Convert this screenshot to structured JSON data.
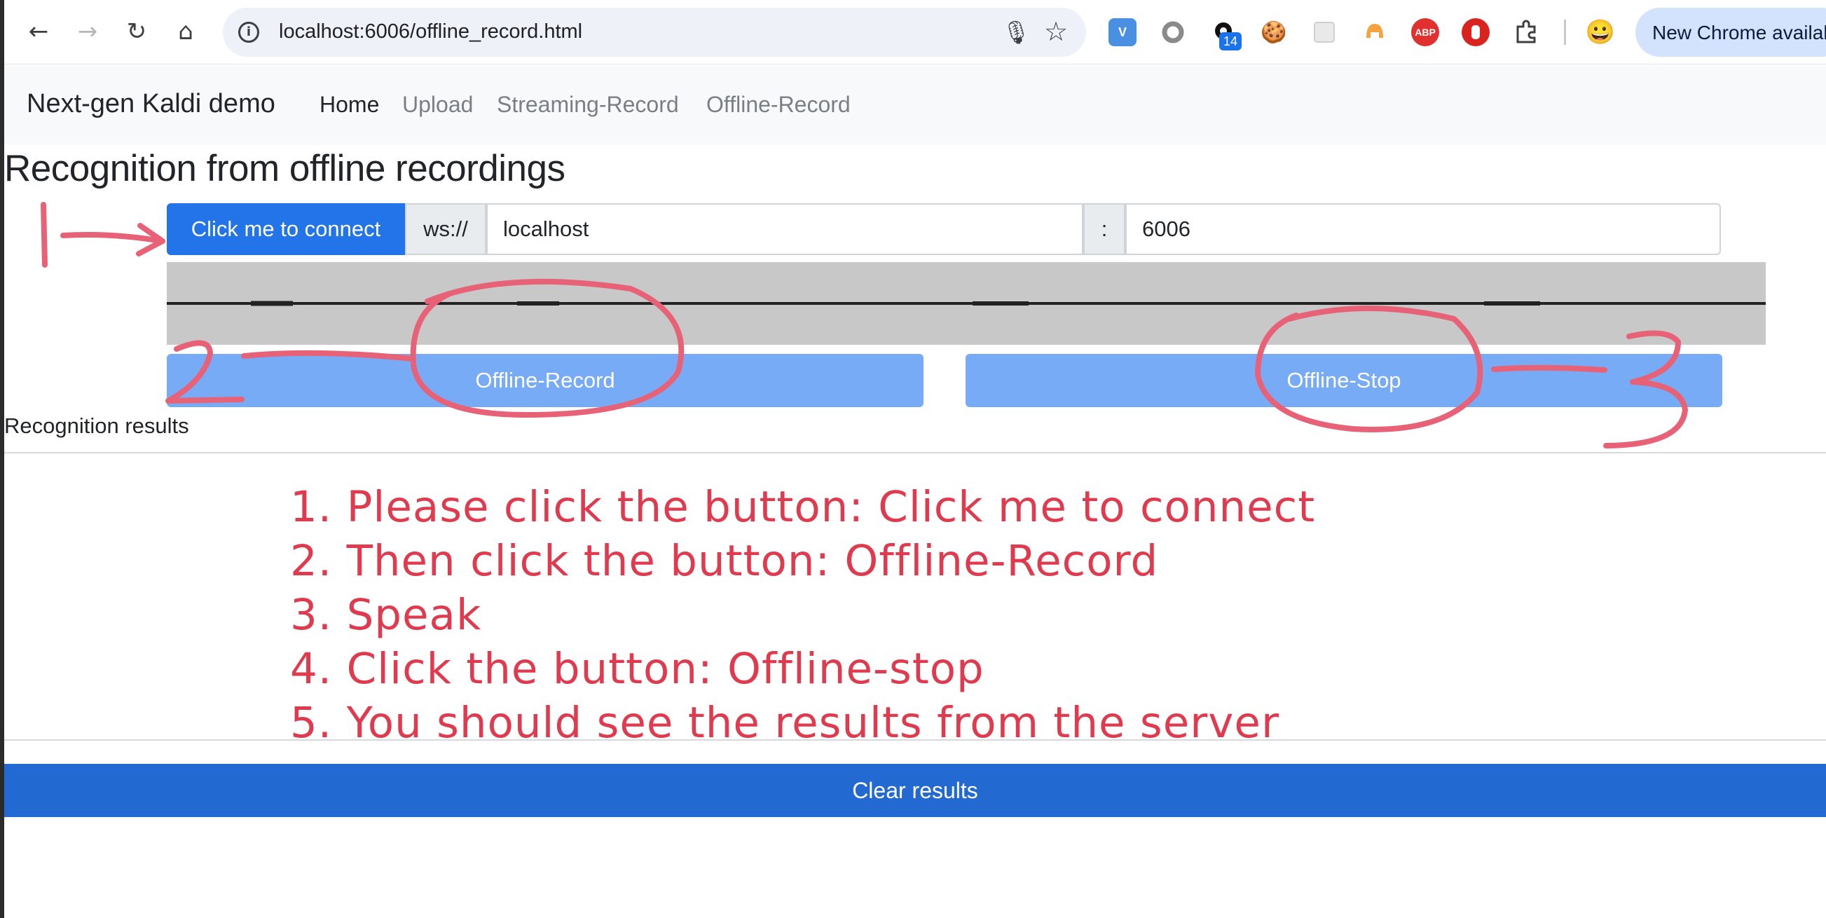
{
  "browser": {
    "url": "localhost:6006/offline_record.html",
    "update_pill": "New Chrome availabl",
    "extension_badge_count": "14",
    "extension_abp_label": "ABP"
  },
  "navbar": {
    "brand": "Next-gen Kaldi demo",
    "links": [
      "Home",
      "Upload",
      "Streaming-Record",
      "Offline-Record"
    ],
    "active": "Home"
  },
  "main": {
    "title": "Recognition from offline recordings",
    "connect_button": "Click me to connect",
    "ws_prefix": "ws://",
    "host_value": "localhost",
    "port_separator": ":",
    "port_value": "6006",
    "record_button": "Offline-Record",
    "stop_button": "Offline-Stop",
    "results_label": "Recognition results",
    "clear_button": "Clear results"
  },
  "annotations": {
    "instructions": [
      "1. Please click the button: Click me to connect",
      "2. Then click the button: Offline-Record",
      "3. Speak",
      "4. Click the button: Offline-stop",
      "5. You should see the results from the server"
    ],
    "markers": [
      "1",
      "2",
      "3"
    ],
    "annotation_color": "#e03a4e"
  },
  "colors": {
    "primary": "#2274e8",
    "primary_disabled": "#78abf6",
    "clear_button": "#2269d2",
    "waveform_bg": "#c8c8c8"
  }
}
